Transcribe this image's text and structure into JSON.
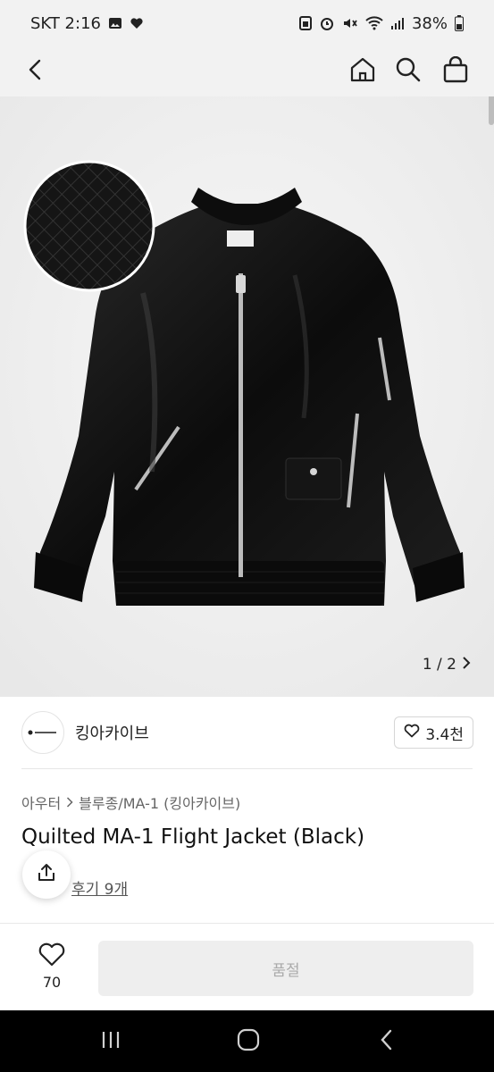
{
  "status_bar": {
    "carrier_time": "SKT 2:16",
    "battery": "38%"
  },
  "nav": {
    "back": "back",
    "home": "home",
    "search": "search",
    "cart": "shopping-bag"
  },
  "gallery": {
    "counter": "1 / 2"
  },
  "shop": {
    "name": "킹아카이브",
    "likes": "3.4천"
  },
  "product": {
    "breadcrumb": [
      "아우터",
      "블루종/MA-1 (킹아카이브)"
    ],
    "title": "Quilted MA-1 Flight Jacket (Black)",
    "review_link": "후기 9개"
  },
  "bottom": {
    "wish_count": "70",
    "buy_label": "품절"
  },
  "colors": {
    "background": "#ffffff",
    "hero_bg": "#f1f1f1",
    "disabled_btn": "#eeeeee"
  }
}
